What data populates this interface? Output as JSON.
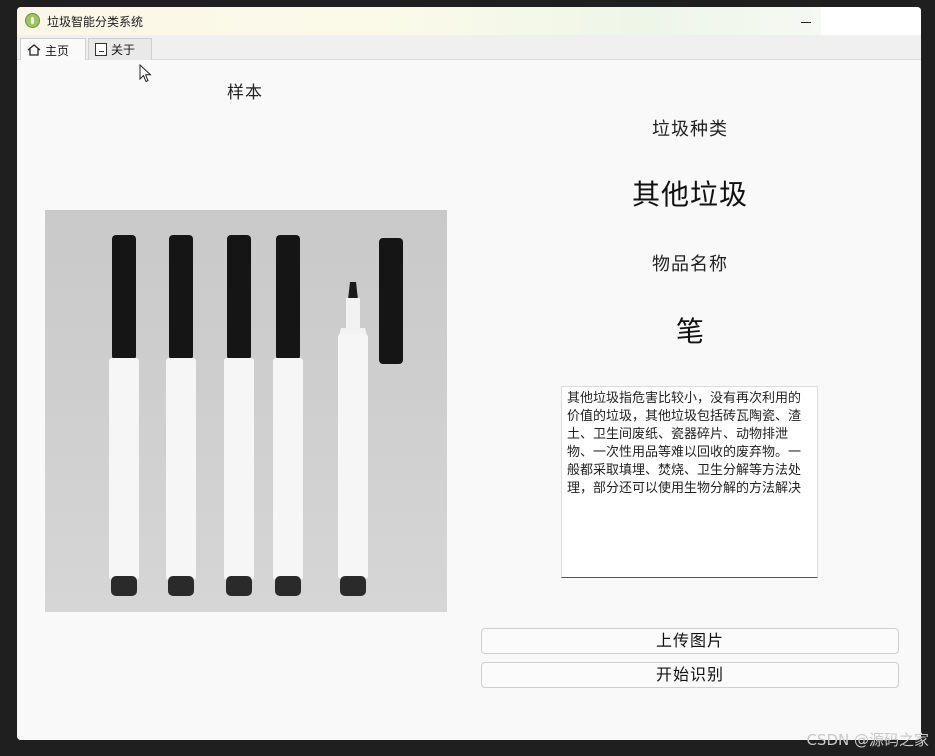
{
  "window": {
    "title": "垃圾智能分类系统"
  },
  "tabs": [
    {
      "label": "主页",
      "icon": "home-icon",
      "active": true
    },
    {
      "label": "关于",
      "icon": "document-icon",
      "active": false
    }
  ],
  "main": {
    "sample_label": "样本",
    "type_heading": "垃圾种类",
    "type_value": "其他垃圾",
    "name_heading": "物品名称",
    "name_value": "笔",
    "description": "其他垃圾指危害比较小，没有再次利用的价值的垃圾，其他垃圾包括砖瓦陶瓷、渣土、卫生间废纸、瓷器碎片、动物排泄物、一次性用品等难以回收的废弃物。一般都采取填埋、焚烧、卫生分解等方法处理，部分还可以使用生物分解的方法解决",
    "upload_label": "上传图片",
    "recognize_label": "开始识别"
  },
  "watermark": "CSDN @源码之家",
  "colors": {
    "window_bg": "#f3f3f3",
    "pen_cap": "#141414",
    "pen_body": "#f5f5f5"
  }
}
